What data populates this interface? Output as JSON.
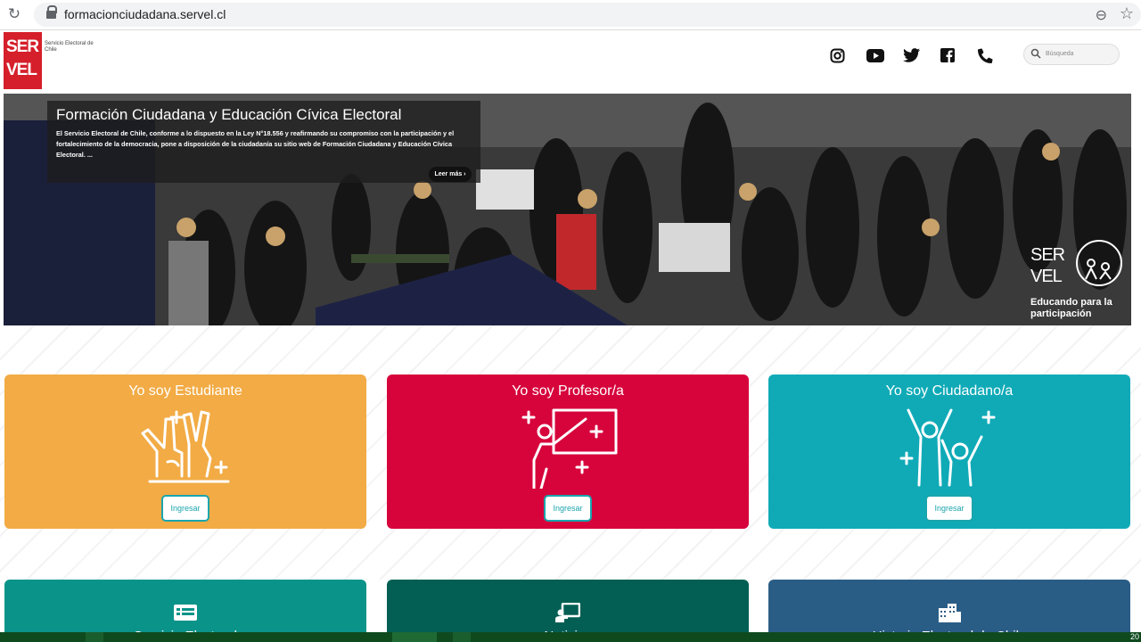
{
  "browser": {
    "url": "formacionciudadana.servel.cl"
  },
  "header": {
    "logo_line1": "SER",
    "logo_line2": "VEL",
    "logo_sub": "Servicio Electoral de Chile",
    "search_placeholder": "Búsqueda"
  },
  "hero": {
    "title": "Formación Ciudadana y Educación Cívica Electoral",
    "text": "El Servicio Electoral de Chile, conforme a lo dispuesto en la Ley N°18.556 y reafirmando su compromiso con la participación y el fortalecimiento de la democracia, pone a disposición de la ciudadanía su sitio web de Formación Ciudadana y Educación Cívica Electoral. ...",
    "button": "Leer más",
    "brand_line1": "SER",
    "brand_line2": "VEL",
    "brand_sub": "Educando para la participación"
  },
  "cards": [
    {
      "title": "Yo soy Estudiante",
      "button": "Ingresar",
      "color": "#f2ab45"
    },
    {
      "title": "Yo soy Profesor/a",
      "button": "Ingresar",
      "color": "#d7043c"
    },
    {
      "title": "Yo soy Ciudadano/a",
      "button": "Ingresar",
      "color": "#10aab7"
    }
  ],
  "bottom_cards": [
    {
      "label": "Servicio Electoral",
      "color": "#0a9389"
    },
    {
      "label": "Noticias",
      "color": "#035f54"
    },
    {
      "label": "Historia Electoral de Chile",
      "color": "#2a5d86"
    }
  ],
  "taskbar": {
    "clock": "20"
  },
  "colors": {
    "servel_red": "#d51f2a",
    "ingresar_border": "#1aa5ad"
  }
}
